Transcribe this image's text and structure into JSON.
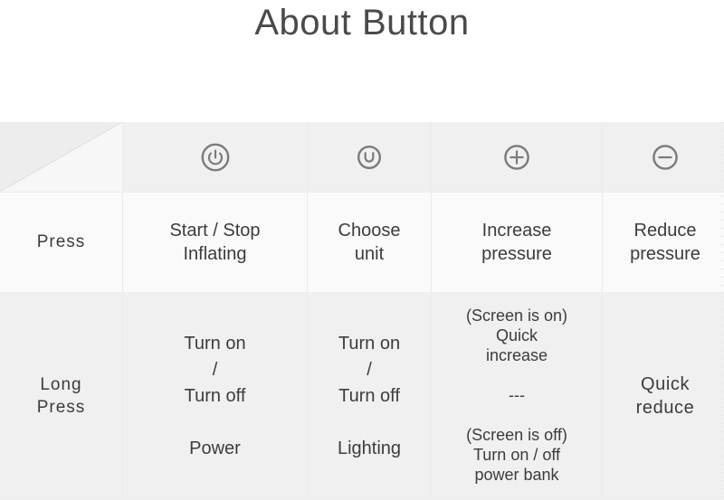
{
  "page": {
    "title": "About Button"
  },
  "table": {
    "header": {
      "corner": "",
      "columns": [
        {
          "icon": "power-icon",
          "glyph": "power"
        },
        {
          "icon": "unit-u-icon",
          "glyph": "U"
        },
        {
          "icon": "plus-icon",
          "glyph": "+"
        },
        {
          "icon": "minus-icon",
          "glyph": "-"
        }
      ]
    },
    "rows": [
      {
        "label": "Press",
        "cells": [
          "Start / Stop\nInflating",
          "Choose\nunit",
          "Increase\npressure",
          "Reduce\npressure"
        ]
      },
      {
        "label": "Long\nPress",
        "cells": [
          "Turn on\n/\nTurn off\n\nPower",
          "Turn on\n/\nTurn off\n\nLighting",
          "(Screen is on)\nQuick\nincrease\n\n---\n\n(Screen is off)\nTurn on / off\npower bank",
          "Quick\nreduce"
        ]
      }
    ]
  },
  "colors": {
    "header_row_bg": "#f0f0f0",
    "press_row_bg": "#fafafa",
    "longpress_row_bg": "#f0f0f0",
    "text": "#3c3c3c",
    "title_text": "#4a4a4a",
    "icon_stroke": "#7b7b7b",
    "grid_line": "#ebebeb",
    "page_bg": "#ffffff"
  }
}
